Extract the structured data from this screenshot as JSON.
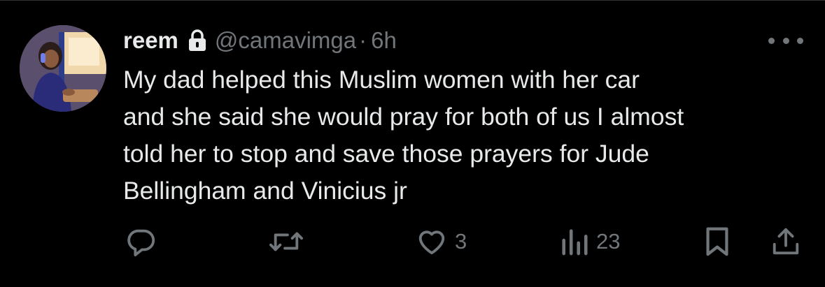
{
  "tweet": {
    "display_name": "reem",
    "handle": "@camavimga",
    "separator": "·",
    "time": "6h",
    "text": "My dad helped this Muslim women with her car\nand she said she would pray for both of us I almost\ntold her to stop and save those prayers for Jude\nBellingham and Vinicius jr",
    "likes": "3",
    "views": "23"
  },
  "icons": {
    "verified_lock": "lock-icon",
    "more": "more-icon",
    "reply": "reply-icon",
    "retweet": "retweet-icon",
    "like": "heart-icon",
    "views": "views-icon",
    "bookmark": "bookmark-icon",
    "share": "share-icon"
  },
  "colors": {
    "background": "#000000",
    "text": "#e7e9ea",
    "muted": "#71767b"
  }
}
